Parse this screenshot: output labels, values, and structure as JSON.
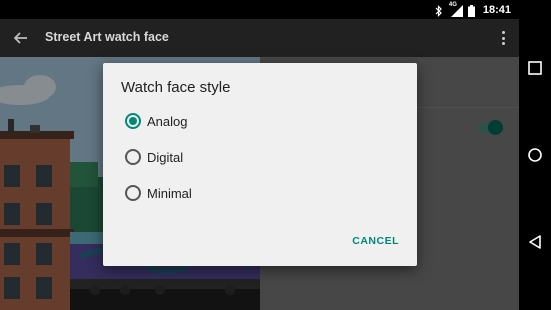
{
  "status_bar": {
    "time": "18:41",
    "network": "4G",
    "icons": [
      "bluetooth-icon",
      "network-signal-icon",
      "battery-icon"
    ]
  },
  "app_bar": {
    "title": "Street Art watch face",
    "back_icon": "back-arrow-icon",
    "overflow_icon": "more-vert-icon"
  },
  "dialog": {
    "title": "Watch face style",
    "options": [
      {
        "label": "Analog",
        "selected": true
      },
      {
        "label": "Digital",
        "selected": false
      },
      {
        "label": "Minimal",
        "selected": false
      }
    ],
    "cancel_label": "CANCEL"
  },
  "settings": {
    "toggle_on": true
  },
  "nav_bar": {
    "icons": [
      "recents-square-icon",
      "home-circle-icon",
      "back-triangle-icon"
    ]
  },
  "colors": {
    "accent": "#00897b",
    "app_bar": "#212121",
    "dialog_bg": "#f0f0f0",
    "sky": "#a9cce2"
  }
}
